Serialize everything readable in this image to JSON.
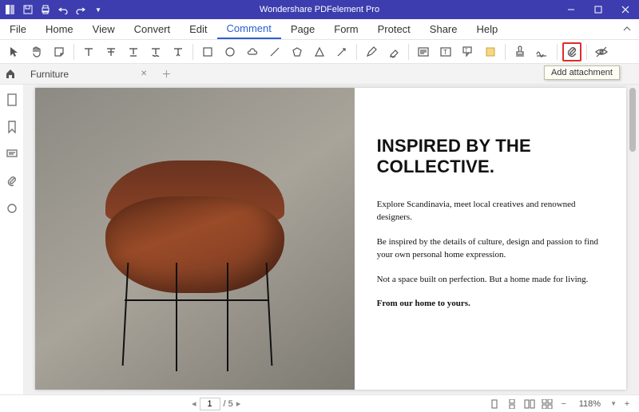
{
  "app_title": "Wondershare PDFelement Pro",
  "menu": {
    "file": "File",
    "home": "Home",
    "view": "View",
    "convert": "Convert",
    "edit": "Edit",
    "comment": "Comment",
    "page": "Page",
    "form": "Form",
    "protect": "Protect",
    "share": "Share",
    "help": "Help"
  },
  "tabs": {
    "doc_name": "Furniture"
  },
  "tooltip": "Add attachment",
  "document": {
    "headline": "INSPIRED BY THE COLLECTIVE.",
    "p1": "Explore Scandinavia, meet local creatives and renowned designers.",
    "p2": "Be inspired by the details of culture, design and passion to find your own personal home expression.",
    "p3": "Not a space built on perfection. But a home made for living.",
    "p4": "From our home to yours."
  },
  "status": {
    "current_page": "1",
    "page_sep": "/ 5",
    "zoom": "118%"
  },
  "icons": {
    "select": "select-tool",
    "hand": "hand-tool",
    "note": "sticky-note",
    "highlight": "highlight-tool",
    "highlight2": "strikeout-tool",
    "underline": "underline-tool",
    "strikethrough": "strikethrough-tool",
    "insert": "caret-tool",
    "rect": "rectangle-shape",
    "circle": "oval-shape",
    "cloud": "cloud-shape",
    "line": "line-shape",
    "polygon": "polygon-shape",
    "triangle": "connected-lines",
    "arrow": "arrow-shape",
    "pencil": "pencil-tool",
    "eraser": "eraser-tool",
    "textbox": "text-comment",
    "textbox2": "text-box",
    "callout": "area-highlight",
    "area": "text-callout",
    "stamp": "stamp-tool",
    "stamp2": "signature-tool",
    "attachment": "attachment-tool",
    "eye": "hide-annotations"
  }
}
